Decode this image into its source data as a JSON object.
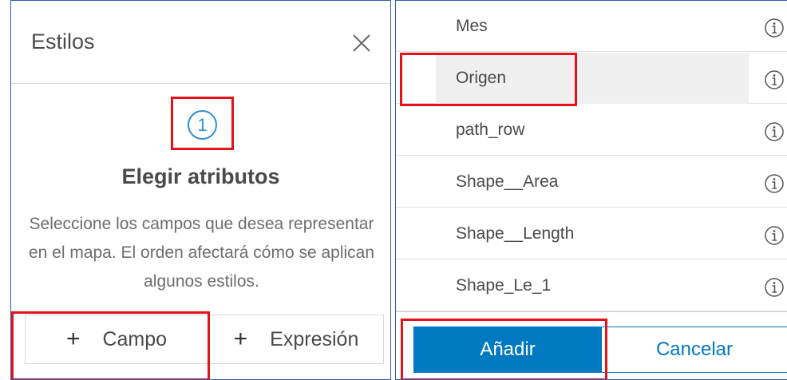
{
  "left_panel": {
    "title": "Estilos",
    "close_icon": "close-icon",
    "step_number": "1",
    "heading": "Elegir atributos",
    "description": "Seleccione los campos que desea representar en el mapa. El orden afectará cómo se aplican algunos estilos.",
    "buttons": {
      "campo": {
        "icon": "+",
        "label": "Campo"
      },
      "expresion": {
        "icon": "+",
        "label": "Expresión"
      }
    }
  },
  "right_panel": {
    "fields": [
      {
        "label": "Mes",
        "icon": "info-icon"
      },
      {
        "label": "Origen",
        "icon": "info-icon",
        "selected": true
      },
      {
        "label": "path_row",
        "icon": "info-icon"
      },
      {
        "label": "Shape__Area",
        "icon": "info-icon"
      },
      {
        "label": "Shape__Length",
        "icon": "info-icon"
      },
      {
        "label": "Shape_Le_1",
        "icon": "info-icon"
      }
    ],
    "add_label": "Añadir",
    "cancel_label": "Cancelar"
  },
  "colors": {
    "accent": "#0079c1",
    "step_circle": "#2f8fd8",
    "highlight_box": "#e3121b",
    "panel_border": "#2f5fb3"
  }
}
